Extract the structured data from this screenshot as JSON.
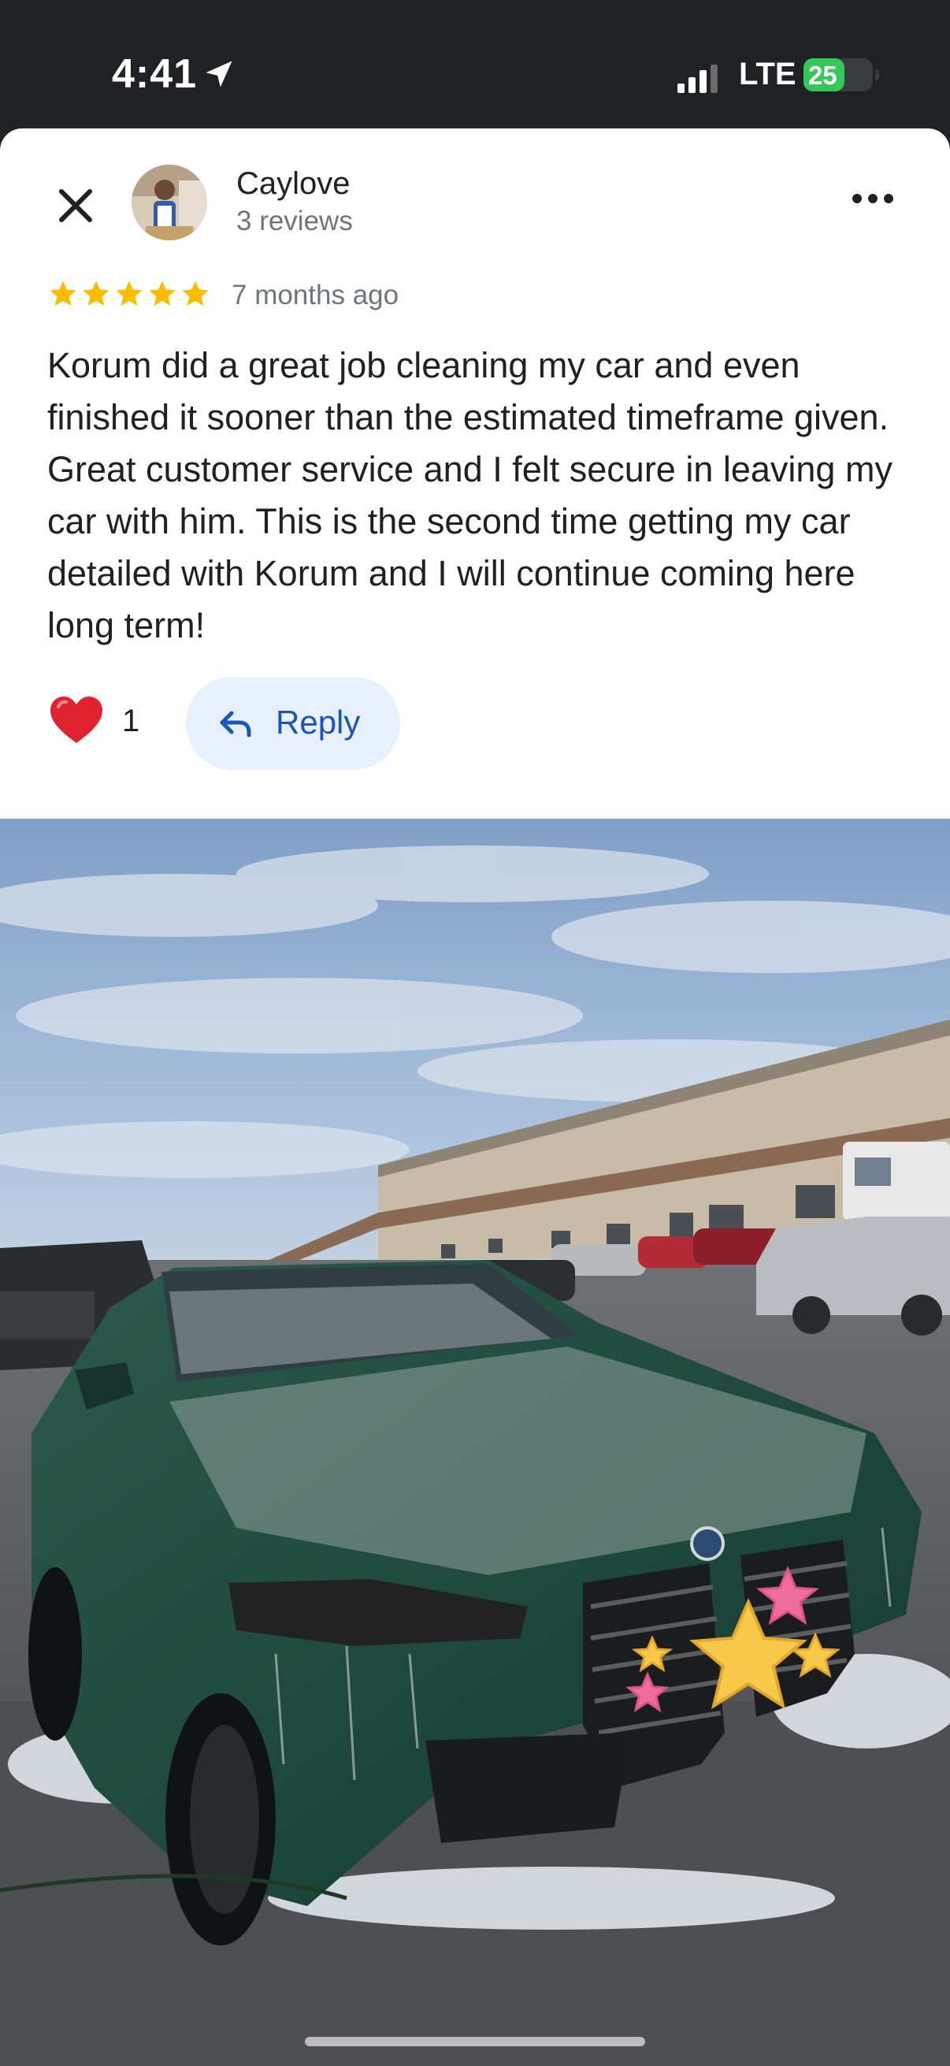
{
  "status_bar": {
    "time": "4:41",
    "network": "LTE",
    "battery_level": "25",
    "battery_percent": 25,
    "icons": [
      "location-arrow-icon",
      "signal-bars-icon",
      "battery-charging-icon"
    ]
  },
  "review": {
    "reviewer_name": "Caylove",
    "reviewer_meta": "3 reviews",
    "rating": 5,
    "time_ago": "7 months ago",
    "text": "Korum did a great job cleaning my car and even finished it sooner than the estimated timeframe given. Great customer service and I felt secure in leaving my car with him. This is the second time getting my car detailed with Korum and I will continue coming here long term!",
    "like_count": "1",
    "reply_label": "Reply"
  },
  "icons": {
    "close": "close-icon",
    "more": "more-options-icon",
    "star": "star-icon",
    "heart": "heart-icon",
    "reply": "reply-arrow-icon"
  },
  "colors": {
    "star": "#fbbc04",
    "heart": "#e0242f",
    "reply_bg": "#e8f0fe",
    "reply_text": "#1a56b8",
    "battery": "#34c759"
  }
}
